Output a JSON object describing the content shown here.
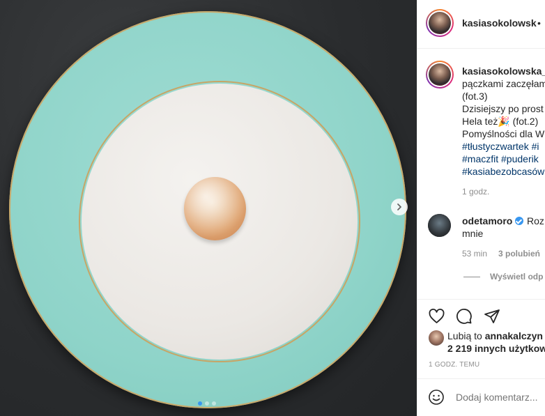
{
  "photo": {
    "carousel_dots": 3,
    "active_dot": 0,
    "next_icon": "chevron-right-icon"
  },
  "header": {
    "username": "kasiasokolowsk",
    "separator": "•"
  },
  "caption": {
    "username": "kasiasokolowska_",
    "lines": [
      "pączkami zaczęłam",
      "(fot.3)",
      "Dzisiejszy po prost",
      "Hela też🎉 (fot.2)",
      "Pomyślności dla W"
    ],
    "hashtag_lines": [
      "#tłustyczwartek #i",
      "#maczfit #puderik",
      "#kasiabezobcasów"
    ],
    "time": "1 godz."
  },
  "comment": {
    "username": "odetamoro",
    "text_line1": "Roz",
    "text_line2": "mnie",
    "time": "53 min",
    "likes": "3 polubień",
    "view_replies": "Wyświetl odp"
  },
  "actions": {
    "like_icon": "heart-icon",
    "comment_icon": "comment-icon",
    "share_icon": "share-icon"
  },
  "likes": {
    "prefix": "Lubią to",
    "user": "annakalczyn",
    "others": "2 219 innych użytkow"
  },
  "post_time": "1 GODZ. TEMU",
  "add_comment": {
    "placeholder": "Dodaj komentarz...",
    "emoji_icon": "smiley-icon"
  },
  "colors": {
    "link": "#003569",
    "verified": "#3897f0",
    "muted": "#8e8e8e",
    "plate_rim": "#8fd4c9"
  }
}
